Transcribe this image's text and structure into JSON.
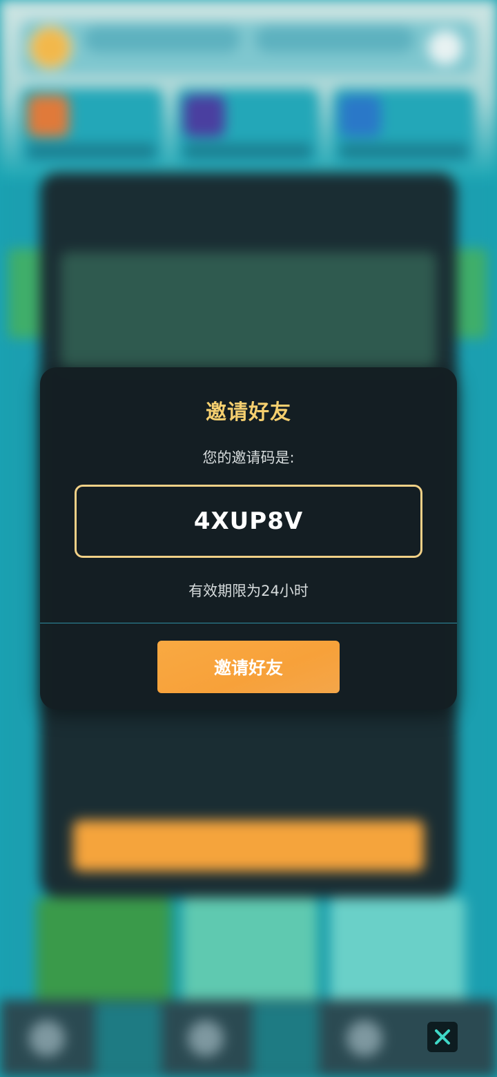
{
  "modal": {
    "title": "邀请好友",
    "subtitle": "您的邀请码是:",
    "invite_code": "4XUP8V",
    "validity_text": "有效期限为24小时",
    "invite_button_label": "邀请好友"
  },
  "close_button": {
    "icon": "close-icon"
  },
  "colors": {
    "modal_background": "#141e22",
    "title_gold": "#f5cf6f",
    "code_border": "#f2d187",
    "button_orange": "#f7a13a",
    "divider_teal": "#2f8fa3",
    "close_accent": "#3fd8c7"
  }
}
